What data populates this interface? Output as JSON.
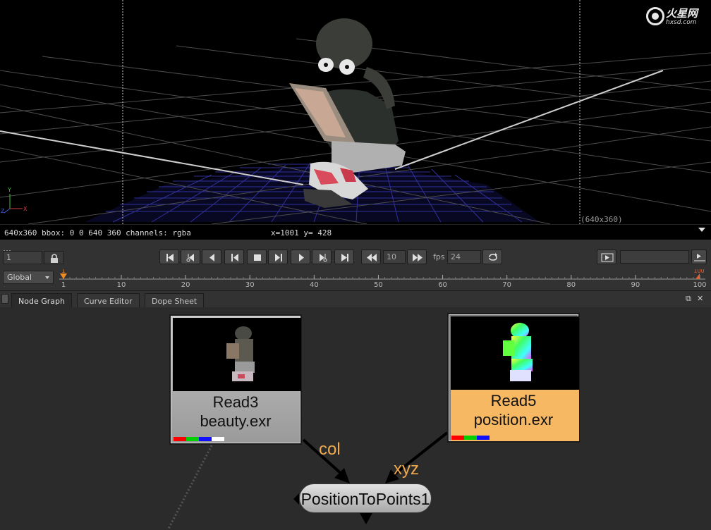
{
  "viewer": {
    "resolution_label": "(640x360)",
    "info_text": "640x360 bbox: 0 0 640 360 channels: rgba",
    "coords_text": "x=1001 y= 428",
    "watermark": {
      "brand": "火星网",
      "url": "hxsd.com"
    }
  },
  "playback": {
    "current_frame": "1",
    "increment": "10",
    "fps_label": "fps",
    "fps": "24",
    "buttons": [
      "first-frame",
      "previous-keyframe",
      "play-backward",
      "previous-frame",
      "stop",
      "next-frame",
      "play-forward",
      "next-keyframe",
      "last-frame",
      "step-back-increment",
      "step-forward-increment",
      "loop-mode",
      "play-range",
      "range-end"
    ]
  },
  "timeline": {
    "range_select": "Global",
    "start_marker": "1",
    "end_marker": "100",
    "ticks": [
      "1",
      "10",
      "20",
      "30",
      "40",
      "50",
      "60",
      "70",
      "80",
      "90",
      "100"
    ]
  },
  "tabs": [
    {
      "label": "Node Graph",
      "active": true
    },
    {
      "label": "Curve Editor",
      "active": false
    },
    {
      "label": "Dope Sheet",
      "active": false
    }
  ],
  "nodes": {
    "read3": {
      "name": "Read3",
      "file": "beauty.exr",
      "channels": [
        "#ff0000",
        "#00d000",
        "#1010ff",
        "#ffffff"
      ]
    },
    "read5": {
      "name": "Read5",
      "file": "position.exr",
      "channels": [
        "#ff0000",
        "#00d000",
        "#1010ff"
      ]
    },
    "p2p": {
      "name": "PositionToPoints1"
    }
  },
  "links": {
    "col": "col",
    "xyz": "xyz"
  },
  "colors": {
    "read5_tile": "#f6b862",
    "link_label": "#f0a94a",
    "viewer_bg": "#000000",
    "panel_bg": "#2b2b2b"
  }
}
